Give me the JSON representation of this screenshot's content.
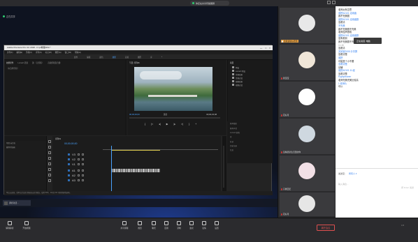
{
  "topbar": {
    "meeting_title": "你还在共享有辅课屏",
    "share_label": "正在共享"
  },
  "premiere": {
    "title": "Adobe Premiere Pro CC 2018 - F:\\pr教程\\654 *",
    "minimize": "—",
    "maximize": "□",
    "close": "×",
    "menu": [
      "文件(F)",
      "编辑(E)",
      "剪辑(C)",
      "序列(S)",
      "标记(M)",
      "图形(G)",
      "窗口(W)",
      "帮助(H)"
    ],
    "workspaces": [
      "组件",
      "编辑",
      "颜色",
      "效果",
      "音频",
      "图形",
      "库",
      "»"
    ],
    "active_workspace": "效果",
    "source_tabs": [
      "效果控件",
      "Lumetri 范围",
      "源:（无剪辑）",
      "音频剪辑混合器:"
    ],
    "source_empty": "（未选择剪辑）",
    "program_tabs": [
      "节目: 序列01"
    ],
    "program_timecode": "00;00;00;00",
    "program_fit": "适合",
    "program_duration": "00;00;23;08",
    "transport": [
      "{",
      "|<",
      "◂|",
      "▶",
      "|▸",
      ">|",
      "}",
      "+"
    ],
    "project_title": "项目",
    "effects_items": [
      "预设",
      "Lumetri 预设",
      "音频效果",
      "音频过渡",
      "视频效果",
      "视频过渡"
    ],
    "effects_panel_labels": [
      "基本图形",
      "基本声音",
      "Lumetri 颜色",
      "库",
      "标记",
      "历史记录",
      "信息"
    ],
    "timeline_tab": "序列01",
    "timeline_timecode": "00;00;00;00",
    "timeline_left_tabs": [
      "项目:未命名",
      "媒体浏览器"
    ],
    "tracks": [
      "V3",
      "V2",
      "V1",
      "A1",
      "A2",
      "A3"
    ],
    "status": "单击以选择，或单击空白处并拖动以进行框选。使用 Shift、Alt 和 Ctrl 可获得其他选项。"
  },
  "share_taskbar": {
    "item_label": "调查对话..."
  },
  "participants": [
    {
      "name": "给我讲讲好老师",
      "avatar_color": "#e8e8e8",
      "mic_on": true
    },
    {
      "name": "我宝宝",
      "avatar_color": "#f0e6d8",
      "mic_on": false
    },
    {
      "name": "花好月",
      "avatar_color": "#ffffff",
      "mic_on": false
    },
    {
      "name": "蓝精灵新生活里的你",
      "avatar_color": "#cfd8e0",
      "mic_on": false
    },
    {
      "name": "只剩回忆",
      "avatar_color": "#f2e0e6",
      "mic_on": false
    },
    {
      "name": "花好月",
      "avatar_color": "#e6e6e6",
      "mic_on": false
    }
  ],
  "chat": {
    "messages": [
      {
        "text": "老师太有意思",
        "style": "normal"
      },
      {
        "text": "谁把A2101 活用函",
        "style": "blue"
      },
      {
        "text": "我不完美剧",
        "style": "normal"
      },
      {
        "text": "谁把A2101 活用函数",
        "style": "blue"
      },
      {
        "text": "没看清",
        "style": "normal"
      },
      {
        "text": "不完美",
        "style": "blue"
      },
      {
        "text": "我不完美剧不完美",
        "style": "normal"
      },
      {
        "text": "老师没声音啦",
        "style": "normal"
      },
      {
        "text": "谁把A2101 活用函数",
        "style": "blue"
      },
      {
        "text": "没有看到",
        "style": "normal"
      },
      {
        "text": "我不完美剧不完美会议",
        "style": "normal"
      },
      {
        "text": "11:46",
        "style": "gray"
      },
      {
        "text": "没看清",
        "style": "normal"
      },
      {
        "text": "关闭室2005 分享屏",
        "style": "blue"
      },
      {
        "text": "没看清楚",
        "style": "normal"
      },
      {
        "text": "谁把",
        "style": "blue"
      },
      {
        "text": "可能是个小不要",
        "style": "normal"
      },
      {
        "text": "没看清楚",
        "style": "blue"
      },
      {
        "text": "请辅",
        "style": "normal"
      },
      {
        "text": "谁把A2101 11:经",
        "style": "blue"
      },
      {
        "text": "没看清楚",
        "style": "normal"
      },
      {
        "text": "Ppphpthoner",
        "style": "blue"
      },
      {
        "text": "老师完美完美比较高",
        "style": "normal"
      },
      {
        "text": "1 老师片",
        "style": "blue"
      },
      {
        "text": "可以",
        "style": "normal"
      }
    ],
    "popup": "正在说话: 电脑",
    "send_to_label": "发送至：",
    "send_to_value": "所有人 ▾",
    "input_placeholder": "输入消息...",
    "send_hint": "按 Enter 发送"
  },
  "toolbar": {
    "left": [
      {
        "label": "解除静音",
        "icon": "mic-icon"
      },
      {
        "label": "开启视频",
        "icon": "camera-icon"
      }
    ],
    "center": [
      {
        "label": "共享屏幕",
        "icon": "share-icon"
      },
      {
        "label": "成员",
        "icon": "members-icon"
      },
      {
        "label": "聊天",
        "icon": "chat-icon"
      },
      {
        "label": "应用",
        "icon": "apps-icon"
      },
      {
        "label": "录制",
        "icon": "record-icon"
      },
      {
        "label": "会议",
        "icon": "meeting-icon"
      },
      {
        "label": "表情",
        "icon": "emoji-icon"
      },
      {
        "label": "设置",
        "icon": "settings-icon"
      }
    ],
    "leave_label": "离开会议",
    "page": "1/9"
  },
  "colors": {
    "accent": "#2e7df0",
    "danger": "#e05050",
    "premiere_blue": "#4aa3ff",
    "work_area": "#d9c84a"
  }
}
